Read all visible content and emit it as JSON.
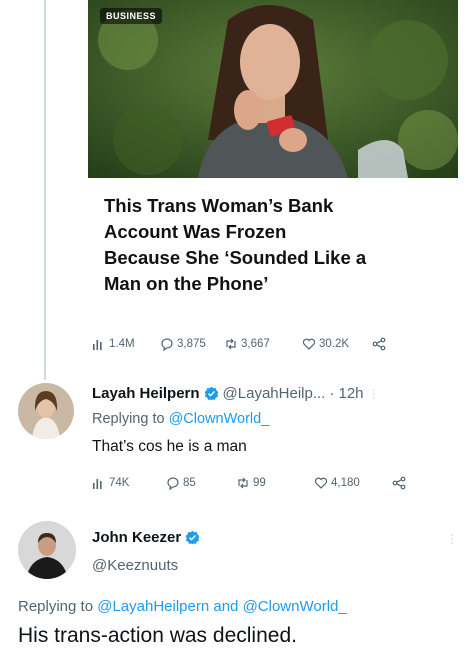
{
  "article": {
    "badge": "BUSINESS",
    "title_lines": [
      "This Trans Woman’s Bank",
      "Account Was Frozen",
      "Because She ‘Sounded Like a",
      "Man on the Phone’"
    ],
    "stats": {
      "views": "1.4M",
      "replies": "3,875",
      "retweets": "3,667",
      "likes": "30.2K"
    }
  },
  "reply1": {
    "name": "Layah Heilpern",
    "handle": "@LayahHeilp...",
    "time": "· 12h",
    "replying_prefix": "Replying to",
    "replying_to": "@ClownWorld_",
    "text": "That’s cos he is a man",
    "stats": {
      "views": "74K",
      "replies": "85",
      "retweets": "99",
      "likes": "4,180"
    }
  },
  "reply2": {
    "name": "John Keezer",
    "handle": "@Keeznuuts",
    "replying_prefix": "Replying to",
    "replying_to_1": "@LayahHeilpern",
    "replying_and": "and",
    "replying_to_2": "@ClownWorld_",
    "text": "His trans-action was declined."
  },
  "colors": {
    "link": "#1d9bf0",
    "muted": "#536471",
    "verified": "#1d9bf0"
  }
}
